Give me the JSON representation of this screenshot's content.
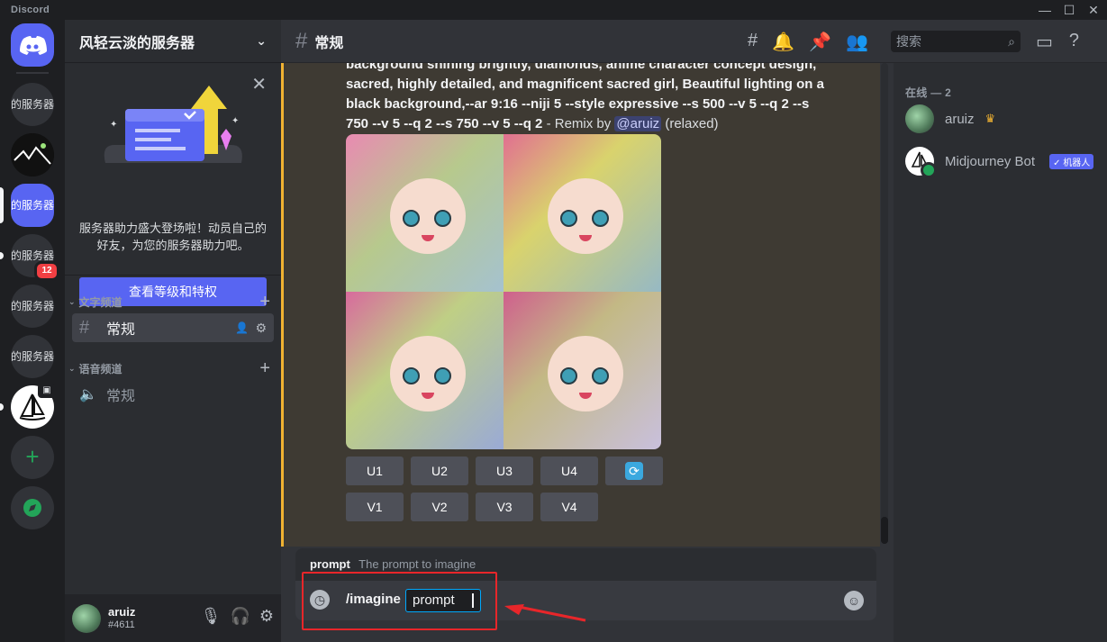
{
  "app": {
    "name": "Discord",
    "window_controls": [
      "—",
      "☐",
      "✕"
    ]
  },
  "server_rail": {
    "items": [
      {
        "label": "的服务器"
      },
      {
        "label": ""
      },
      {
        "label": "轻云淡的服务器"
      },
      {
        "label": "的服务器"
      },
      {
        "label": "燕的服务器"
      },
      {
        "label": "续的服务器"
      }
    ],
    "mention_badge": "12"
  },
  "sidebar": {
    "server_name": "风轻云淡的服务器",
    "boost": {
      "text": "服务器助力盛大登场啦！动员自己的好友，为您的服务器助力吧。",
      "button": "查看等级和特权"
    },
    "text_category": "文字频道",
    "voice_category": "语音频道",
    "text_channel": "常规",
    "voice_channel": "常规"
  },
  "user": {
    "name": "aruiz",
    "tag": "#4611"
  },
  "header": {
    "channel": "常规",
    "search_placeholder": "搜索"
  },
  "message": {
    "line1": "background shining brightly, diamonds, anime character concept design,",
    "line2": "sacred, highly detailed, and magnificent sacred girl, Beautiful lighting on a",
    "line3": "black background,--ar 9:16 --niji 5 --style expressive --s 500 --v 5 --q 2 --s",
    "line4": "750 --v 5 --q 2 --s 750 --v 5 --q 2",
    "remix": " - Remix by ",
    "mention": "@aruiz",
    "mode": " (relaxed)"
  },
  "buttons": {
    "upscale": [
      "U1",
      "U2",
      "U3",
      "U4"
    ],
    "variation": [
      "V1",
      "V2",
      "V3",
      "V4"
    ]
  },
  "composer": {
    "option_name": "prompt",
    "option_desc": "The prompt to imagine",
    "command": "/imagine",
    "arg": "prompt"
  },
  "members": {
    "header": "在线 — 2",
    "list": [
      {
        "name": "aruiz",
        "crown": "♛"
      },
      {
        "name": "Midjourney Bot",
        "badge": "✓ 机器人"
      }
    ]
  },
  "colors": {
    "accent": "#5865f2",
    "highlight": "#f0b232",
    "annotation": "#e8262a",
    "online": "#23a559"
  }
}
